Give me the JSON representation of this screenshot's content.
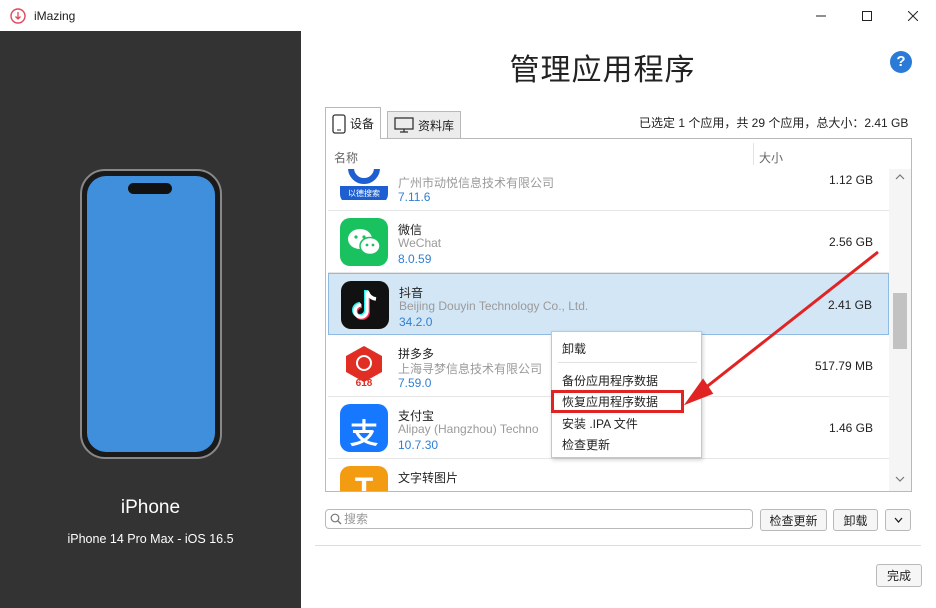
{
  "window": {
    "title": "iMazing"
  },
  "device": {
    "name": "iPhone",
    "model": "iPhone 14 Pro Max - iOS 16.5"
  },
  "main": {
    "title": "管理应用程序",
    "help_label": "?",
    "tabs": [
      {
        "label": "设备"
      },
      {
        "label": "资料库"
      }
    ],
    "selection_summary": "已选定 1 个应用，共 29 个应用，总大小：2.41 GB",
    "columns": {
      "name": "名称",
      "size": "大小"
    }
  },
  "apps": [
    {
      "name": "",
      "vendor": "广州市动悦信息技术有限公司",
      "version": "7.11.6",
      "size": "1.12 GB",
      "icon_label": "以德搜索",
      "icon": "search-app-icon"
    },
    {
      "name": "微信",
      "vendor": "WeChat",
      "version": "8.0.59",
      "size": "2.56 GB",
      "icon": "wechat-icon"
    },
    {
      "name": "抖音",
      "vendor": "Beijing Douyin Technology Co., Ltd.",
      "version": "34.2.0",
      "size": "2.41 GB",
      "icon": "douyin-icon",
      "selected": true
    },
    {
      "name": "拼多多",
      "vendor": "上海寻梦信息技术有限公司",
      "version": "7.59.0",
      "size": "517.79 MB",
      "icon_label": "618",
      "icon": "pinduoduo-icon"
    },
    {
      "name": "支付宝",
      "vendor": "Alipay (Hangzhou) Techno",
      "version": "10.7.30",
      "size": "1.46 GB",
      "icon_label": "支",
      "icon": "alipay-icon"
    },
    {
      "name": "文字转图片",
      "vendor": "",
      "version": "",
      "size": "",
      "icon_label": "T",
      "icon": "text-to-image-icon"
    }
  ],
  "context_menu": {
    "items": [
      "卸载",
      "备份应用程序数据",
      "恢复应用程序数据",
      "安装 .IPA 文件",
      "检查更新"
    ]
  },
  "bottom": {
    "search_placeholder": "搜索",
    "check_updates": "检查更新",
    "uninstall": "卸载",
    "done": "完成"
  },
  "colors": {
    "accent": "#2a7bd8",
    "selection": "#d3e6f5",
    "highlight": "#e02424",
    "device_panel": "#333333"
  }
}
